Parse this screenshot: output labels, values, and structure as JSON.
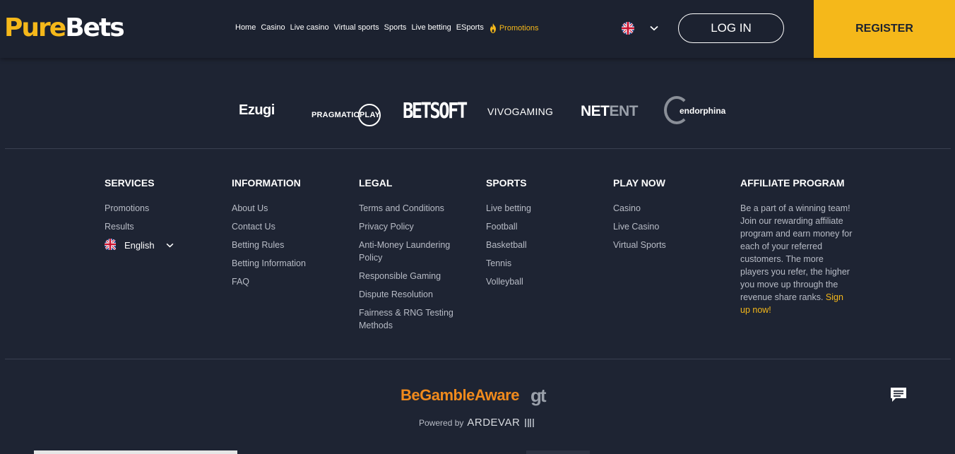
{
  "header": {
    "logo_pure": "Pure",
    "logo_bets": "Bets",
    "nav": [
      "Home",
      "Casino",
      "Live casino",
      "Virtual sports",
      "Sports",
      "Live betting",
      "ESports"
    ],
    "promotions_label": "Promotions",
    "language_icon": "uk-flag-icon",
    "login_label": "LOG IN",
    "register_label": "REGISTER"
  },
  "providers": {
    "ezugi": "Ezugi",
    "pragmatic": "PRAGMATIC",
    "pragmatic_play": "PLAY",
    "betsoft": "BETSOFT",
    "vivo": "VIVOGAMING",
    "netent_net": "NET",
    "netent_ent": "ENT",
    "endorphina": "endorphina"
  },
  "footer": {
    "services": {
      "title": "SERVICES",
      "links": [
        "Promotions",
        "Results"
      ],
      "language": "English"
    },
    "information": {
      "title": "INFORMATION",
      "links": [
        "About Us",
        "Contact Us",
        "Betting Rules",
        "Betting Information",
        "FAQ"
      ]
    },
    "legal": {
      "title": "LEGAL",
      "links": [
        "Terms and Conditions",
        "Privacy Policy",
        "Anti-Money Laundering Policy",
        "Responsible Gaming",
        "Dispute Resolution",
        "Fairness & RNG Testing Methods"
      ]
    },
    "sports": {
      "title": "SPORTS",
      "links": [
        "Live betting",
        "Football",
        "Basketball",
        "Tennis",
        "Volleyball"
      ]
    },
    "play_now": {
      "title": "PLAY NOW",
      "links": [
        "Casino",
        "Live Casino",
        "Virtual Sports"
      ]
    },
    "affiliate": {
      "title": "AFFILIATE PROGRAM",
      "text": "Be a part of a winning team! Join our rewarding affiliate program and earn money for each of your referred customers. The more players you refer, the higher you move up through the revenue share ranks. ",
      "signup": "Sign up now!"
    }
  },
  "bottom": {
    "begambleaware": "BeGambleAware",
    "gt": "gt",
    "powered_by": "Powered by",
    "powered_brand": "ARDEVAR"
  },
  "colors": {
    "background": "#1e2433",
    "accent": "#f5b81a",
    "gamble_orange": "#f08a1c"
  }
}
